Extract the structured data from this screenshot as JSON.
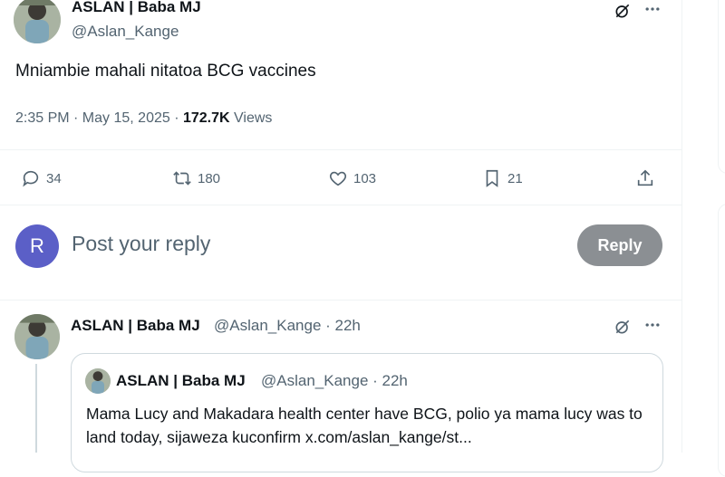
{
  "main_tweet": {
    "author_name": "ASLAN | Baba MJ",
    "handle": "@Aslan_Kange",
    "text": "Mniambie mahali nitatoa BCG vaccines",
    "time": "2:35 PM · May 15, 2025 · ",
    "views_count": "172.7K",
    "views_label": " Views",
    "actions": {
      "replies": "34",
      "reposts": "180",
      "likes": "103",
      "bookmarks": "21"
    }
  },
  "reply_box": {
    "avatar_letter": "R",
    "placeholder": "Post your reply",
    "button_label": "Reply"
  },
  "reply_tweet": {
    "author_name": "ASLAN | Baba MJ",
    "handle_time": "@Aslan_Kange · 22h",
    "quote": {
      "author_name": "ASLAN | Baba MJ",
      "handle_time": "@Aslan_Kange · 22h",
      "text": "Mama Lucy and Makadara health center have BCG, polio ya mama lucy was to land today, sijaweza kuconfirm x.com/aslan_kange/st..."
    }
  },
  "icons": [
    "grok-icon",
    "more-icon",
    "reply-icon",
    "repost-icon",
    "like-icon",
    "bookmark-icon",
    "share-icon"
  ],
  "colors": {
    "reply_avatar": "#5b5fc7",
    "reply_button": "#8b8f93",
    "muted_text": "#536471"
  }
}
